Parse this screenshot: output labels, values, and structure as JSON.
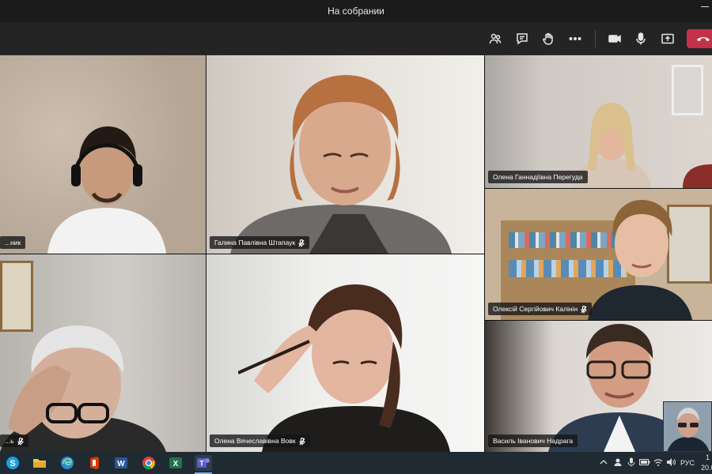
{
  "window": {
    "title": "На собрании"
  },
  "toolbar": {
    "buttons": [
      {
        "name": "participants-icon"
      },
      {
        "name": "chat-icon"
      },
      {
        "name": "raise-hand-icon"
      },
      {
        "name": "more-actions-icon"
      },
      {
        "name": "camera-icon"
      },
      {
        "name": "microphone-icon"
      },
      {
        "name": "share-screen-icon"
      },
      {
        "name": "hang-up-icon"
      }
    ],
    "hangup_color": "#c4314b"
  },
  "participants": [
    {
      "name": "...ник",
      "position": "top-left"
    },
    {
      "name": "Галина Павлівна Штапаук",
      "position": "top-middle"
    },
    {
      "name": "Олена Ганнадіївна Перегуда",
      "position": "right-1"
    },
    {
      "name": "Олексій Сергійович Калінін",
      "position": "right-2"
    },
    {
      "name": "...ь",
      "position": "bottom-left"
    },
    {
      "name": "Олена Вячеславівна Вовк",
      "position": "bottom-middle"
    },
    {
      "name": "Василь Іванович Надрага",
      "position": "right-3"
    }
  ],
  "taskbar": {
    "apps": [
      {
        "name": "skype-icon",
        "label": "S",
        "color": "#1b9de2"
      },
      {
        "name": "file-explorer-icon",
        "label": "",
        "color": "#f3c247"
      },
      {
        "name": "edge-icon",
        "label": "e",
        "color": "#2a8ad6"
      },
      {
        "name": "office-icon",
        "label": "",
        "color": "#d83b01"
      },
      {
        "name": "word-icon",
        "label": "W",
        "color": "#2b579a"
      },
      {
        "name": "chrome-icon",
        "label": "",
        "color": "#e6a72a"
      },
      {
        "name": "excel-icon",
        "label": "X",
        "color": "#217346"
      },
      {
        "name": "teams-icon",
        "label": "T",
        "color": "#5b5fc7"
      }
    ],
    "tray": {
      "language": "РУС",
      "time": "1",
      "date": "20.0"
    }
  }
}
